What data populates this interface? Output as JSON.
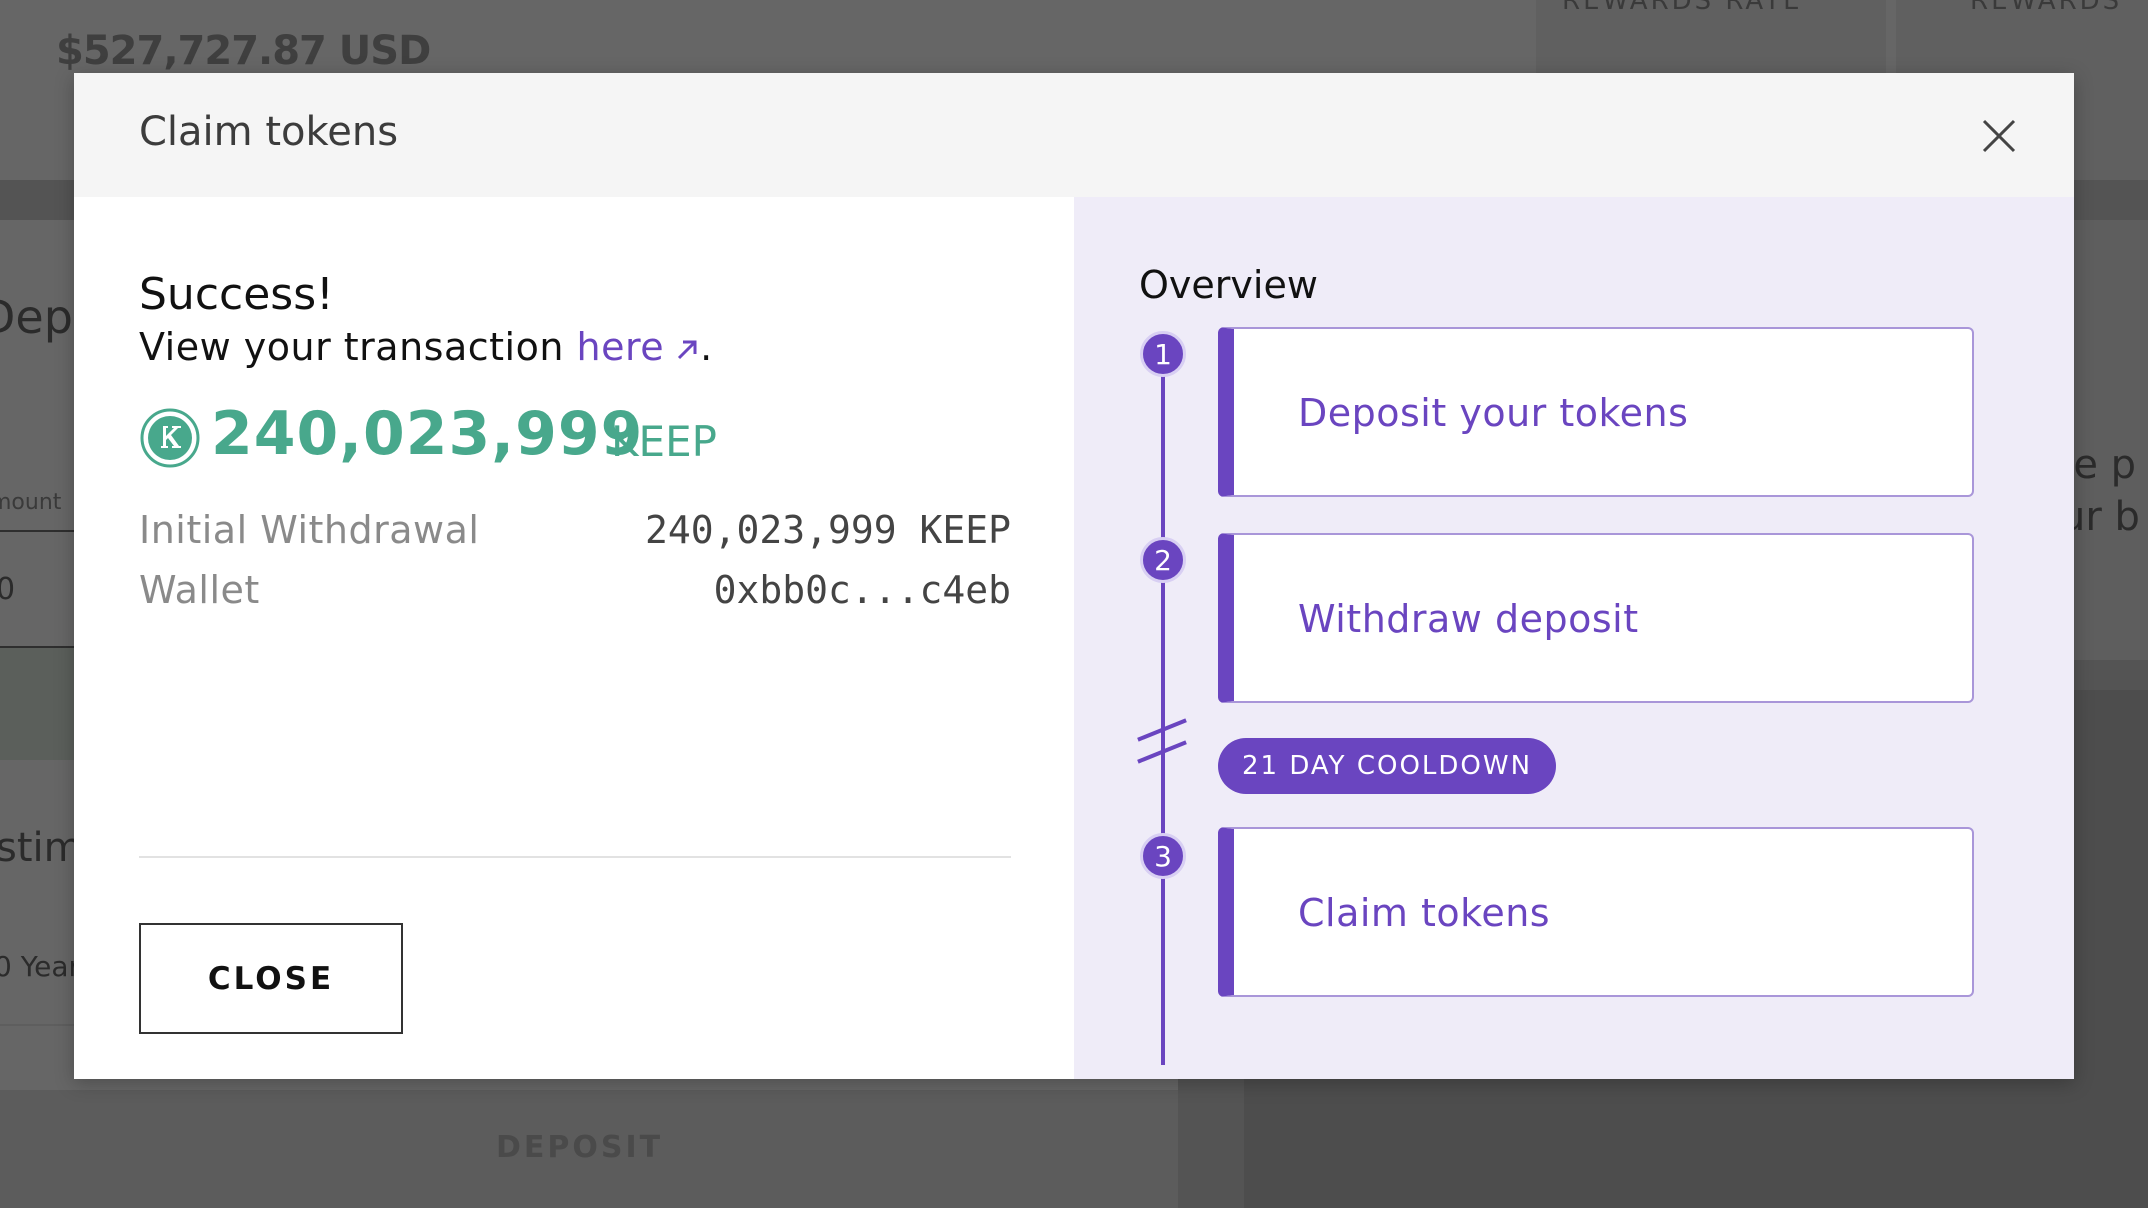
{
  "background": {
    "balance": "$527,727.87 USD",
    "column_1": "REWARDS RATE",
    "column_2": "REWARDS",
    "left_title": "Depo",
    "amount_label": "mount",
    "input_value": "0",
    "estimate_title": "stim",
    "year_label": "0 Year",
    "deposit_button": "DEPOSIT",
    "right_text_1": "he p",
    "right_text_2": "ur b"
  },
  "modal": {
    "title": "Claim tokens",
    "close_icon": "close-icon",
    "success_heading": "Success!",
    "view_tx_prefix": "View your transaction ",
    "view_tx_link": "here",
    "view_tx_suffix": ".",
    "token": {
      "icon": "keep-token-icon",
      "amount": "240,023,999",
      "unit": "KEEP"
    },
    "details": [
      {
        "label": "Initial Withdrawal",
        "value": "240,023,999 KEEP"
      },
      {
        "label": "Wallet",
        "value": "0xbb0c...c4eb"
      }
    ],
    "close_button": "CLOSE",
    "overview": {
      "title": "Overview",
      "steps": [
        {
          "number": "1",
          "label": "Deposit your tokens"
        },
        {
          "number": "2",
          "label": "Withdraw deposit"
        },
        {
          "number": "3",
          "label": "Claim tokens"
        }
      ],
      "cooldown_badge": "21 DAY COOLDOWN"
    }
  },
  "colors": {
    "accent_purple": "#6a45c0",
    "token_green": "#48a88c",
    "overlay": "#545454",
    "overview_bg": "#efecf8"
  }
}
